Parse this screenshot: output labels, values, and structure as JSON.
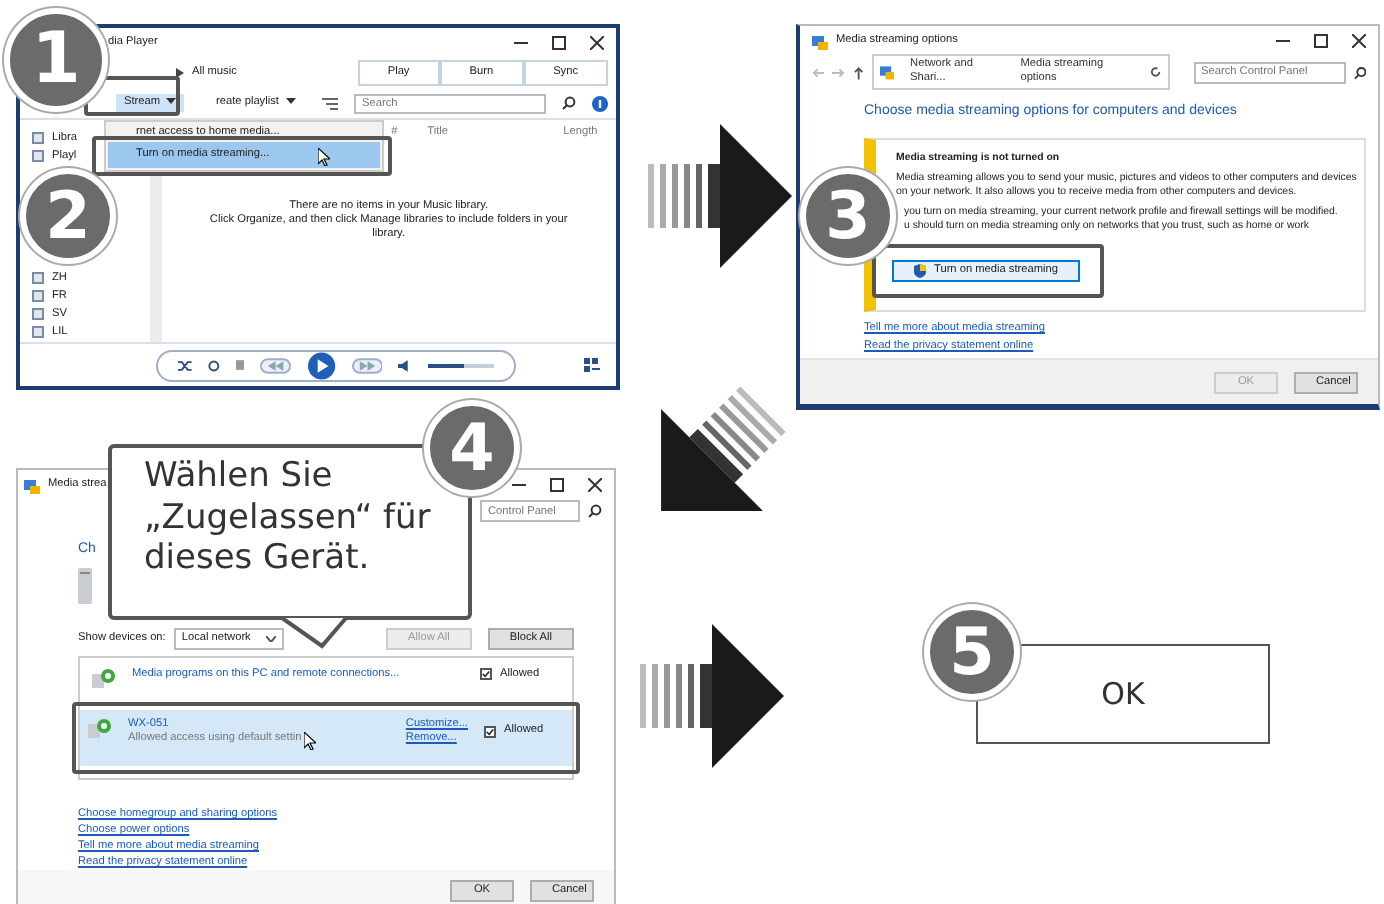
{
  "steps": [
    "1",
    "2",
    "3",
    "4",
    "5"
  ],
  "player": {
    "title": "dia Player",
    "breadcrumb": "All music",
    "tabs": [
      {
        "label": "Play"
      },
      {
        "label": "Burn"
      },
      {
        "label": "Sync"
      }
    ],
    "stream": "Stream",
    "create_playlist": "reate playlist",
    "search_placeholder": "Search",
    "menu": [
      {
        "label": "rnet access to home media...",
        "highlighted": false
      },
      {
        "label": "Turn on media streaming...",
        "highlighted": true
      }
    ],
    "columns": [
      "#",
      "Title",
      "Length"
    ],
    "tree_top": [
      "Libra",
      "Playl"
    ],
    "tree_groups": [
      "ZH",
      "FR",
      "SV",
      "LIL"
    ],
    "empty": [
      "There are no items in your Music library.",
      "Click Organize, and then click Manage libraries to include folders in your library."
    ],
    "volume": {
      "level": 0.55
    }
  },
  "streaming": {
    "title": "Media streaming options",
    "path": [
      "Network and Shari...",
      "Media streaming options"
    ],
    "search_placeholder": "Search Control Panel",
    "heading": "Choose media streaming options for computers and devices",
    "notice_title": "Media streaming is not turned on",
    "notice_text": [
      "Media streaming allows you to send your music, pictures and videos to other computers and devices on your network.  It also allows you to receive media from other computers and devices.",
      "you turn on media streaming, your current network profile and firewall settings will be modified.",
      "u should turn on media streaming only on networks that you trust, such as home or work"
    ],
    "button": "Turn on media streaming",
    "links": [
      "Tell me more about media streaming",
      "Read the privacy statement online"
    ],
    "footer": [
      {
        "label": "OK",
        "disabled": true
      },
      {
        "label": "Cancel",
        "disabled": false
      }
    ]
  },
  "devices": {
    "title": "Media strea",
    "search_placeholder": "Control Panel",
    "heading": "Ch",
    "show_label": "Show devices on:",
    "network": "Local network",
    "actions": [
      {
        "label": "Allow All",
        "disabled": true
      },
      {
        "label": "Block All",
        "disabled": false
      }
    ],
    "rows": [
      {
        "name": "Media programs on this PC and remote connections...",
        "status": "",
        "allowed": true,
        "allowed_label": "Allowed",
        "selected": false,
        "options": []
      },
      {
        "name": "WX-051",
        "status": "Allowed access using default settin",
        "allowed": true,
        "allowed_label": "Allowed",
        "selected": true,
        "options": [
          "Customize...",
          "Remove..."
        ]
      }
    ],
    "links": [
      "Choose homegroup and sharing options",
      "Choose power options",
      "Tell me more about media streaming",
      "Read the privacy statement online"
    ],
    "footer": [
      {
        "label": "OK",
        "disabled": false
      },
      {
        "label": "Cancel",
        "disabled": false
      }
    ]
  },
  "callout": "Wählen Sie „Zugelassen“ für dieses Gerät.",
  "result": "OK"
}
